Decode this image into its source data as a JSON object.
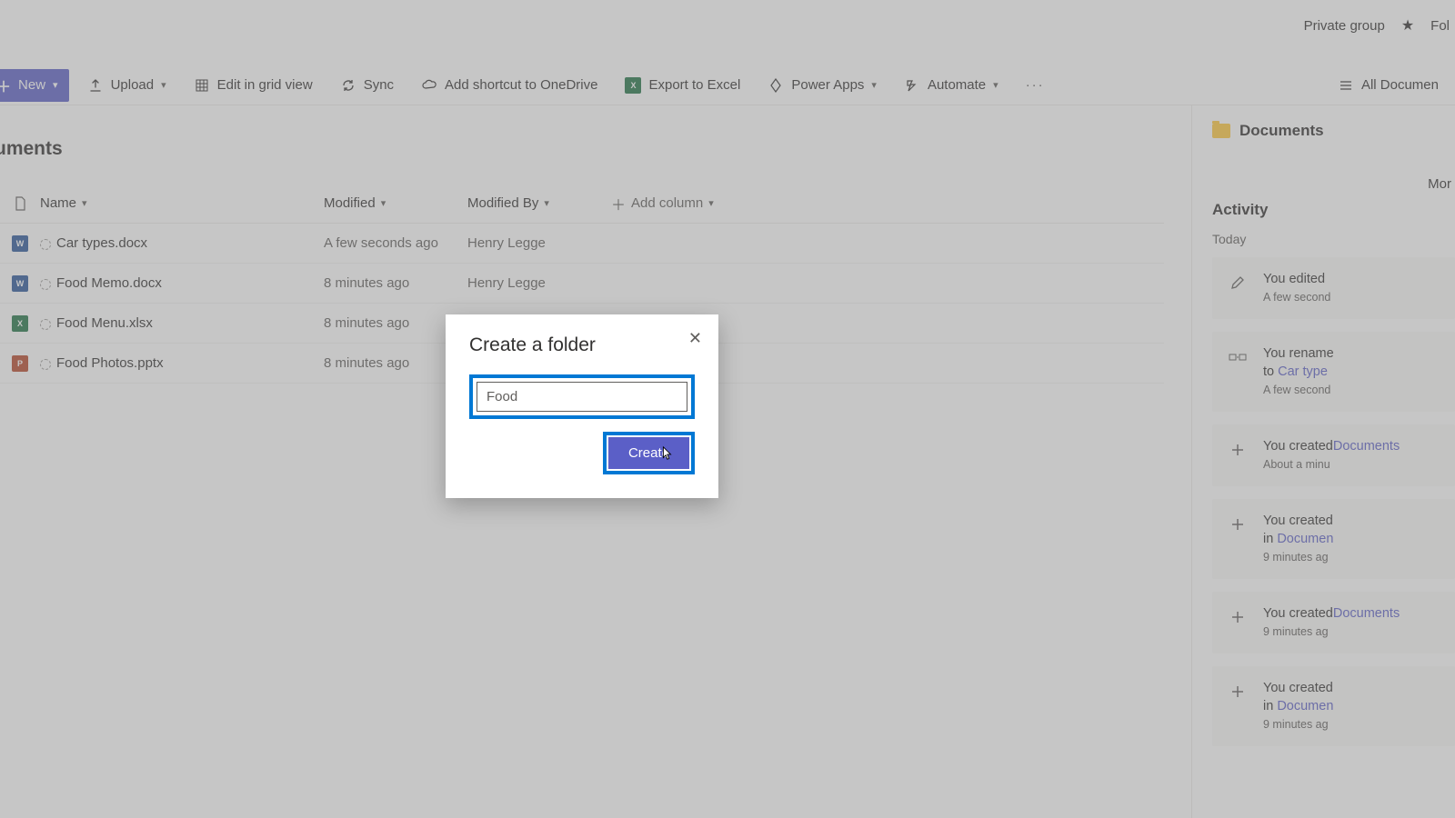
{
  "topbar": {
    "group_label": "Private group",
    "follow_label": "Fol"
  },
  "commands": {
    "new": "New",
    "upload": "Upload",
    "edit_grid": "Edit in grid view",
    "sync": "Sync",
    "add_shortcut": "Add shortcut to OneDrive",
    "export_excel": "Export to Excel",
    "power_apps": "Power Apps",
    "automate": "Automate",
    "all_documents": "All Documen"
  },
  "page_title": "uments",
  "columns": {
    "name": "Name",
    "modified": "Modified",
    "modified_by": "Modified By",
    "add_column": "Add column"
  },
  "rows": [
    {
      "icon": "word",
      "name": "Car types.docx",
      "modified": "A few seconds ago",
      "by": "Henry Legge"
    },
    {
      "icon": "word",
      "name": "Food Memo.docx",
      "modified": "8 minutes ago",
      "by": "Henry Legge"
    },
    {
      "icon": "excel",
      "name": "Food Menu.xlsx",
      "modified": "8 minutes ago",
      "by": ""
    },
    {
      "icon": "ppt",
      "name": "Food Photos.pptx",
      "modified": "8 minutes ago",
      "by": ""
    }
  ],
  "right": {
    "header": "Documents",
    "more": "Mor",
    "activity": "Activity",
    "today": "Today",
    "items": [
      {
        "icon": "pencil",
        "line1": "You edited ",
        "link": "",
        "time": "A few second"
      },
      {
        "icon": "rename",
        "line1": "You rename",
        "line2": "to ",
        "link": "Car type",
        "time": "A few second"
      },
      {
        "icon": "plus",
        "line1": "You created",
        "link": "Documents",
        "time": "About a minu"
      },
      {
        "icon": "plus",
        "line1": "You created",
        "line2": "in ",
        "link": "Documen",
        "time": "9 minutes ag"
      },
      {
        "icon": "plus",
        "line1": "You created",
        "link": "Documents",
        "time": "9 minutes ag"
      },
      {
        "icon": "plus",
        "line1": "You created",
        "line2": "in ",
        "link": "Documen",
        "time": "9 minutes ag"
      }
    ]
  },
  "dialog": {
    "title": "Create a folder",
    "value": "Food",
    "create": "Create"
  },
  "file_colors": {
    "word": "#2b579a",
    "excel": "#217346",
    "ppt": "#b7472a"
  },
  "file_glyph": {
    "word": "W",
    "excel": "X",
    "ppt": "P"
  }
}
